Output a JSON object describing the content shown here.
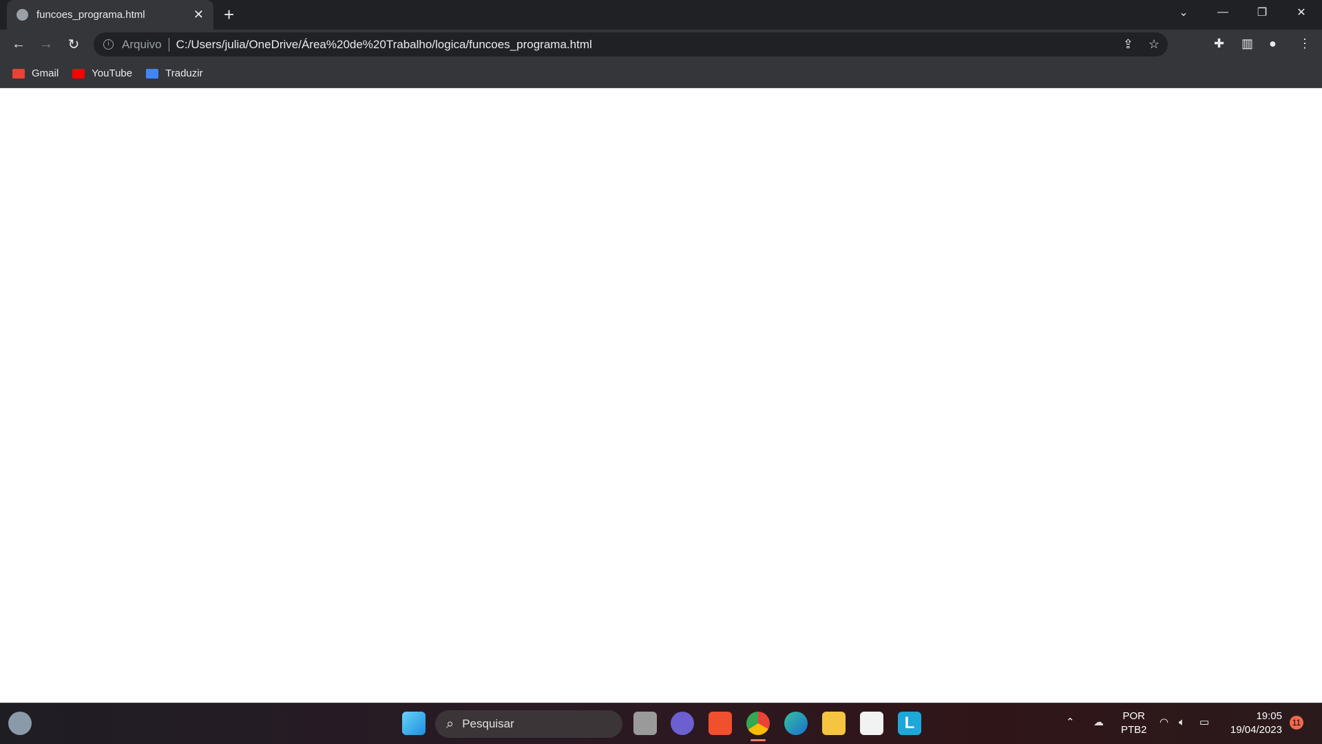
{
  "browser": {
    "tab": {
      "title": "funcoes_programa.html",
      "close_label": "✕",
      "icon": "globe-icon"
    },
    "new_tab_label": "+",
    "address": {
      "scheme_label": "Arquivo",
      "url": "C:/Users/julia/OneDrive/Área%20de%20Trabalho/logica/funcoes_programa.html"
    },
    "bookmarks": [
      {
        "label": "Gmail",
        "icon": "gmail-icon",
        "color": "#ea4335"
      },
      {
        "label": "YouTube",
        "icon": "youtube-icon",
        "color": "#ff0000"
      },
      {
        "label": "Traduzir",
        "icon": "google-translate-icon",
        "color": "#4285f4"
      }
    ]
  },
  "taskbar": {
    "search_placeholder": "Pesquisar",
    "language": {
      "line1": "POR",
      "line2": "PTB2"
    },
    "time": "19:05",
    "date": "19/04/2023",
    "notification_count": "11"
  }
}
